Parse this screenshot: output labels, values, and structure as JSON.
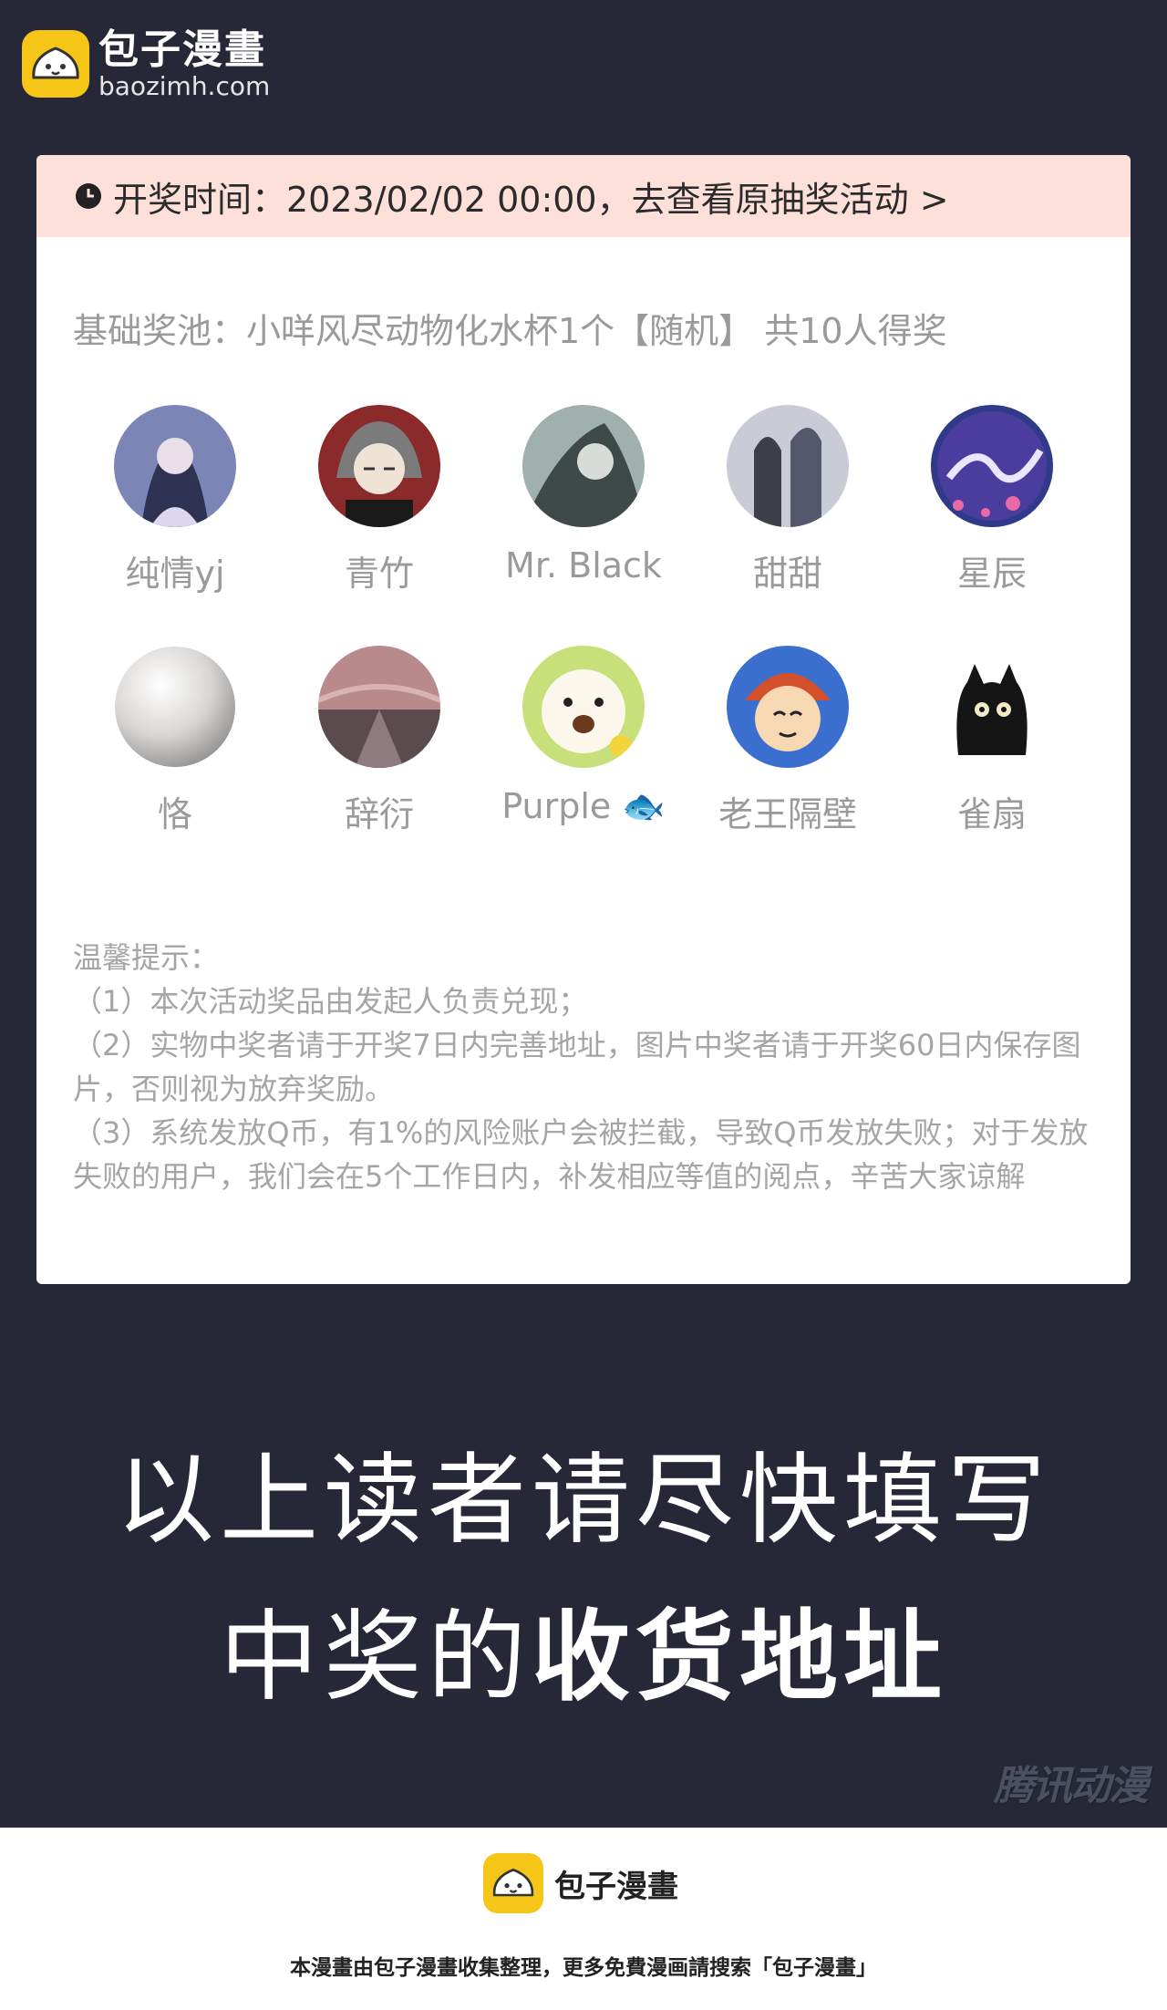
{
  "brand": {
    "name": "包子漫畫",
    "domain": "baozimh.com",
    "accent_color": "#f5c518"
  },
  "lottery": {
    "header_text": "开奖时间：2023/02/02 00:00，去查看原抽奖活动 >",
    "header_bg": "#fde0da",
    "pool_text": "基础奖池：小咩风尽动物化水杯1个【随机】 共10人得奖",
    "winners": [
      {
        "name": "纯情yj",
        "avatar": "anime-avatar-icon"
      },
      {
        "name": "青竹",
        "avatar": "anime-avatar-icon"
      },
      {
        "name": "Mr. Black",
        "avatar": "anime-avatar-icon"
      },
      {
        "name": "甜甜",
        "avatar": "photo-avatar-icon"
      },
      {
        "name": "星辰",
        "avatar": "dragon-avatar-icon"
      },
      {
        "name": "恪",
        "avatar": "pearl-avatar-icon"
      },
      {
        "name": "辞衍",
        "avatar": "landscape-avatar-icon"
      },
      {
        "name": "Purple 🐟",
        "avatar": "cartoon-avatar-icon"
      },
      {
        "name": "老王隔壁",
        "avatar": "cartoon-face-avatar-icon"
      },
      {
        "name": "雀扇",
        "avatar": "black-cat-avatar-icon"
      }
    ]
  },
  "tips": {
    "title": "温馨提示：",
    "item1": "（1）本次活动奖品由发起人负责兑现；",
    "item2": "（2）实物中奖者请于开奖7日内完善地址，图片中奖者请于开奖60日内保存图片，否则视为放弃奖励。",
    "item3": "（3）系统发放Q币，有1%的风险账户会被拦截，导致Q币发放失败；对于发放失败的用户，我们会在5个工作日内，补发相应等值的阅点，辛苦大家谅解"
  },
  "notice": {
    "line1": "以上读者请尽快填写",
    "line2_normal": "中奖的",
    "line2_bold": "收货地址"
  },
  "watermark": "腾讯动漫",
  "footer": {
    "name": "包子漫畫",
    "text": "本漫畫由包子漫畫收集整理，更多免費漫画請搜索「包子漫畫」"
  }
}
